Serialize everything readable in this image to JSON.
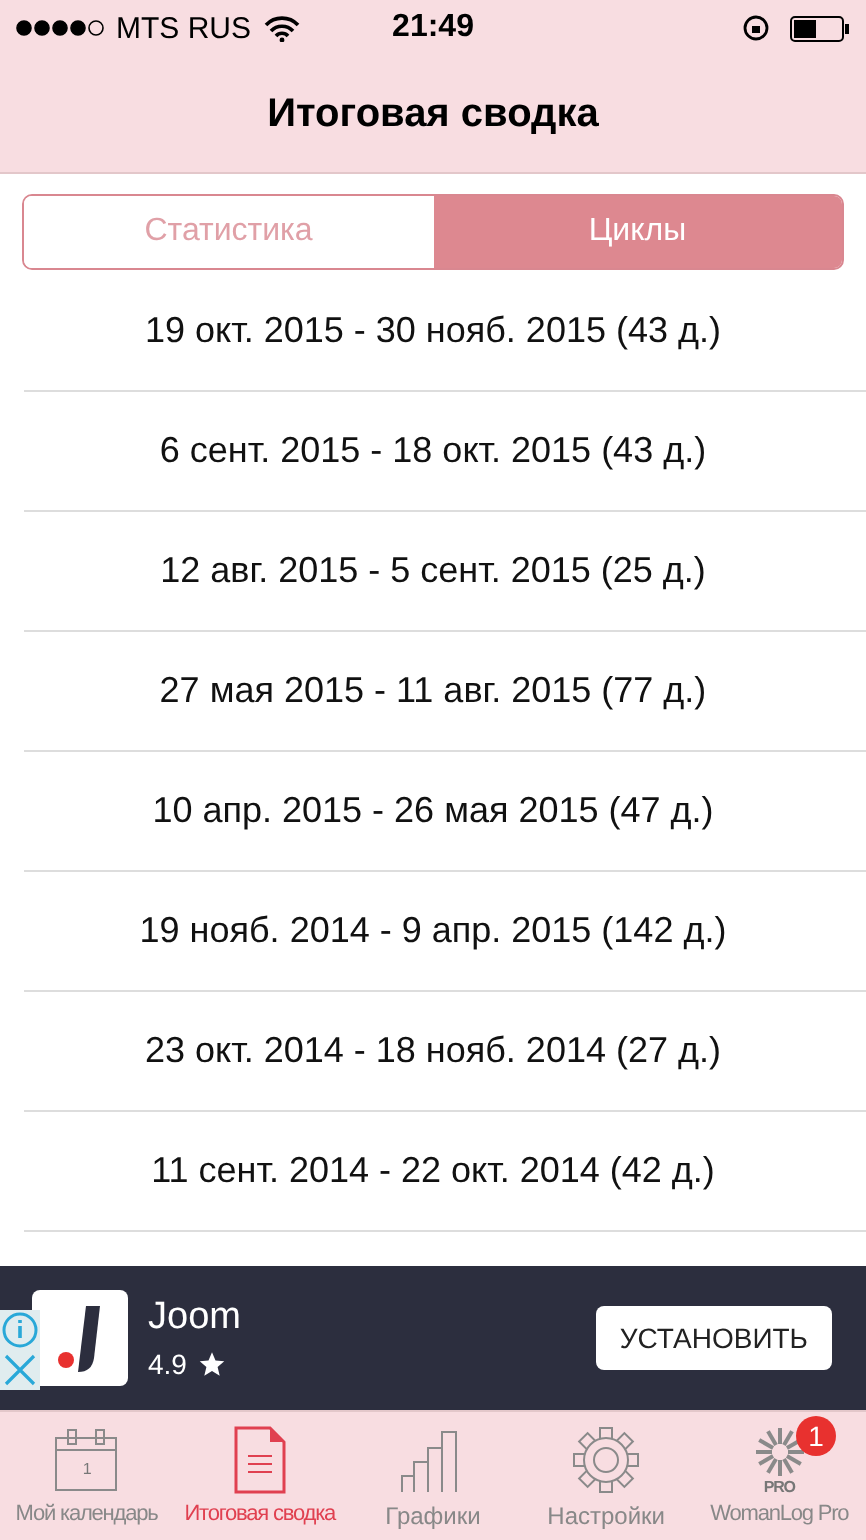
{
  "status_bar": {
    "carrier": "MTS RUS",
    "time": "21:49"
  },
  "nav": {
    "title": "Итоговая сводка"
  },
  "segments": [
    {
      "label": "Статистика",
      "selected": false
    },
    {
      "label": "Циклы",
      "selected": true
    }
  ],
  "cycles": [
    "19 окт. 2015 - 30 нояб. 2015 (43 д.)",
    "6 сент. 2015 - 18 окт. 2015 (43 д.)",
    "12 авг. 2015 - 5 сент. 2015 (25 д.)",
    "27 мая 2015 - 11 авг. 2015 (77 д.)",
    "10 апр. 2015 - 26 мая 2015 (47 д.)",
    "19 нояб. 2014 - 9 апр. 2015 (142 д.)",
    "23 окт. 2014 - 18 нояб. 2014 (27 д.)",
    "11 сент. 2014 - 22 окт. 2014 (42 д.)"
  ],
  "ad": {
    "app_name": "Joom",
    "rating": "4.9",
    "button": "УСТАНОВИТЬ"
  },
  "tab_bar": [
    {
      "kind": "calendar",
      "label": "Мой календарь",
      "icon_text": "1",
      "selected": false
    },
    {
      "kind": "summary",
      "label": "Итоговая сводка",
      "selected": true
    },
    {
      "kind": "charts",
      "label": "Графики",
      "selected": false
    },
    {
      "kind": "settings",
      "label": "Настройки",
      "selected": false
    },
    {
      "kind": "pro",
      "label": "WomanLog Pro",
      "icon_text": "PRO",
      "badge": "1",
      "selected": false
    }
  ]
}
